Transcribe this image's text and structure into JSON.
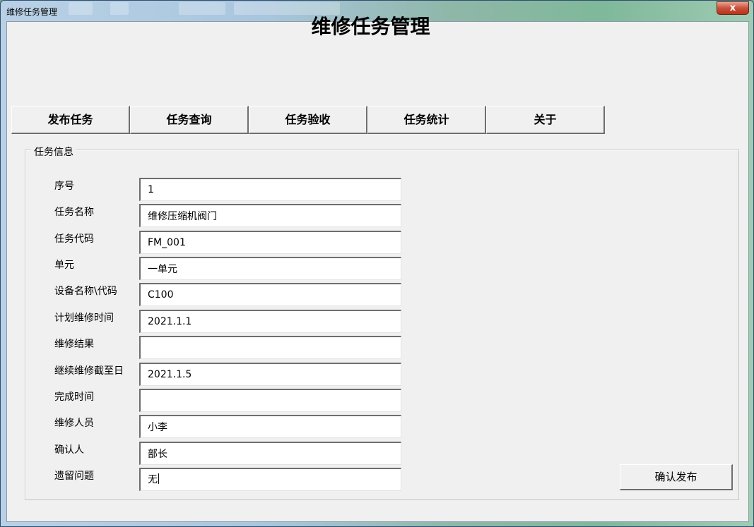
{
  "window": {
    "title": "维修任务管理",
    "close_glyph": "x"
  },
  "app": {
    "title": "维修任务管理"
  },
  "tabs": [
    {
      "label": "发布任务"
    },
    {
      "label": "任务查询"
    },
    {
      "label": "任务验收"
    },
    {
      "label": "任务统计"
    },
    {
      "label": "关于"
    }
  ],
  "task_info": {
    "legend": "任务信息",
    "fields": [
      {
        "label": "序号",
        "value": "1"
      },
      {
        "label": "任务名称",
        "value": "维修压缩机阀门"
      },
      {
        "label": "任务代码",
        "value": "FM_001"
      },
      {
        "label": "单元",
        "value": "一单元"
      },
      {
        "label": "设备名称\\代码",
        "value": "C100"
      },
      {
        "label": "计划维修时间",
        "value": "2021.1.1"
      },
      {
        "label": "维修结果",
        "value": ""
      },
      {
        "label": "继续维修截至日",
        "value": "2021.1.5"
      },
      {
        "label": "完成时间",
        "value": ""
      },
      {
        "label": "维修人员",
        "value": "小李"
      },
      {
        "label": "确认人",
        "value": "部长"
      },
      {
        "label": "遗留问题",
        "value": "无"
      }
    ]
  },
  "actions": {
    "confirm_label": "确认发布"
  }
}
